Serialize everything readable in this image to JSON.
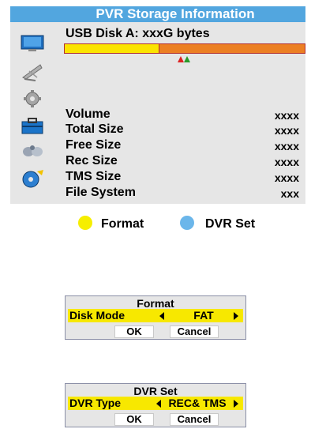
{
  "panel": {
    "title": "PVR Storage Information",
    "disk_label": "USB Disk A: xxxG bytes",
    "usage_fraction": 0.39,
    "info": [
      {
        "label": "Volume",
        "value": "xxxx"
      },
      {
        "label": "Total Size",
        "value": "xxxx"
      },
      {
        "label": "Free Size",
        "value": "xxxx"
      },
      {
        "label": "Rec Size",
        "value": "xxxx"
      },
      {
        "label": "TMS Size",
        "value": "xxxx"
      },
      {
        "label": "File System",
        "value": "xxx"
      }
    ],
    "side_icons": [
      "monitor-icon",
      "satellite-dish-icon",
      "gear-icon",
      "toolbox-icon",
      "joystick-icon",
      "disc-icon"
    ]
  },
  "keys": {
    "format_label": "Format",
    "format_color": "#f6ee00",
    "dvr_label": "DVR Set",
    "dvr_color": "#6bb6ea"
  },
  "format_dialog": {
    "title": "Format",
    "row_label": "Disk Mode",
    "row_value": "FAT",
    "ok_label": "OK",
    "cancel_label": "Cancel"
  },
  "dvr_dialog": {
    "title": "DVR Set",
    "row_label": "DVR Type",
    "row_value": "REC& TMS",
    "ok_label": "OK",
    "cancel_label": "Cancel"
  },
  "colors": {
    "title_bar": "#52a6df",
    "used": "#fbe400",
    "free": "#ec7f22",
    "highlight": "#f7e800"
  }
}
